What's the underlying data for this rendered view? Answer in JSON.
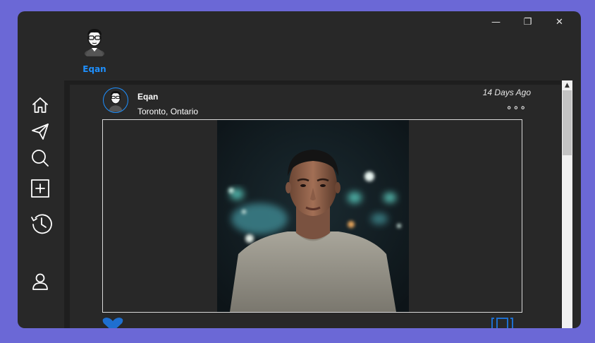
{
  "window": {
    "controls": {
      "minimize_icon": "—",
      "maximize_icon": "❐",
      "close_icon": "✕"
    }
  },
  "profile": {
    "name": "Eqan",
    "avatar_icon": "avatar-cartoon"
  },
  "sidebar": {
    "items": [
      {
        "name": "home",
        "icon": "home-icon"
      },
      {
        "name": "messages",
        "icon": "paper-plane-icon"
      },
      {
        "name": "search",
        "icon": "search-icon"
      },
      {
        "name": "new-post",
        "icon": "plus-square-icon"
      },
      {
        "name": "history",
        "icon": "history-icon"
      },
      {
        "name": "profile",
        "icon": "user-icon"
      }
    ]
  },
  "post": {
    "username": "Eqan",
    "location": "Toronto, Ontario",
    "time": "14 Days Ago",
    "more_glyph": "∘∘∘",
    "image_subject": "man in grey t-shirt with city night bokeh",
    "actions": {
      "like_icon": "heart-icon",
      "save_icon": "bookmark-icon"
    }
  },
  "colors": {
    "background": "#6b68d6",
    "window": "#282828",
    "feed": "#1e1e1e",
    "accent": "#1e90ff",
    "text": "#ffffff"
  }
}
